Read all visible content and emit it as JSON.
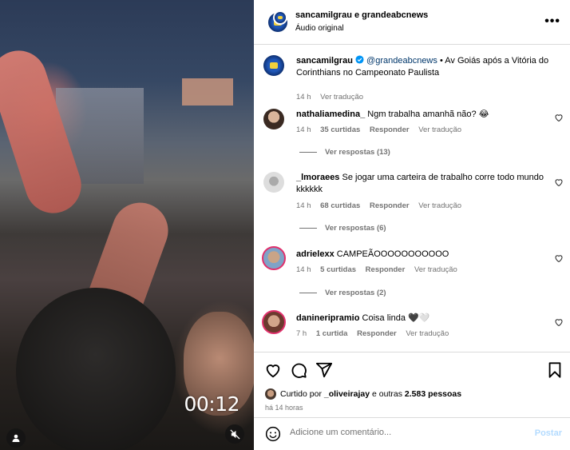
{
  "video": {
    "timer": "00:12"
  },
  "header": {
    "names": "sancamilgrau e grandeabcnews",
    "audio": "Áudio original"
  },
  "caption": {
    "user": "sancamilgrau",
    "mention": "@grandeabcnews",
    "text": "• Av Goiás após a Vitória do Corinthians no Campeonato Paulista",
    "time": "14 h",
    "translate": "Ver tradução"
  },
  "comments": [
    {
      "user": "nathaliamedina_",
      "text": "Ngm trabalha amanhã não? 😂",
      "time": "14 h",
      "likes": "35 curtidas",
      "reply": "Responder",
      "translate": "Ver tradução",
      "replies": "Ver respostas (13)"
    },
    {
      "user": "_lmoraees",
      "text": "Se jogar uma carteira de trabalho corre todo mundo kkkkkk",
      "time": "14 h",
      "likes": "68 curtidas",
      "reply": "Responder",
      "translate": "Ver tradução",
      "replies": "Ver respostas (6)"
    },
    {
      "user": "adrielexx",
      "text": "CAMPEÃOOOOOOOOOOO",
      "time": "14 h",
      "likes": "5 curtidas",
      "reply": "Responder",
      "translate": "Ver tradução",
      "replies": "Ver respostas (2)"
    },
    {
      "user": "danineripramio",
      "text": "Coisa linda 🖤🤍",
      "time": "7 h",
      "likes": "1 curtida",
      "reply": "Responder",
      "translate": "Ver tradução"
    }
  ],
  "likes": {
    "prefix": "Curtido por",
    "user": "_oliveirajay",
    "suffix": "e outras",
    "count": "2.583 pessoas",
    "ago": "há 14 horas"
  },
  "add_comment": {
    "placeholder": "Adicione um comentário...",
    "post": "Postar"
  },
  "icons": [
    "heart-icon",
    "comment-icon",
    "share-icon",
    "bookmark-icon",
    "emoji-icon",
    "more-icon",
    "mute-icon",
    "user-tag-icon",
    "verified-icon"
  ],
  "colors": {
    "link": "#00376b",
    "verified": "#0095f6",
    "post_disabled": "#b3dbff",
    "muted_text": "#737373"
  }
}
